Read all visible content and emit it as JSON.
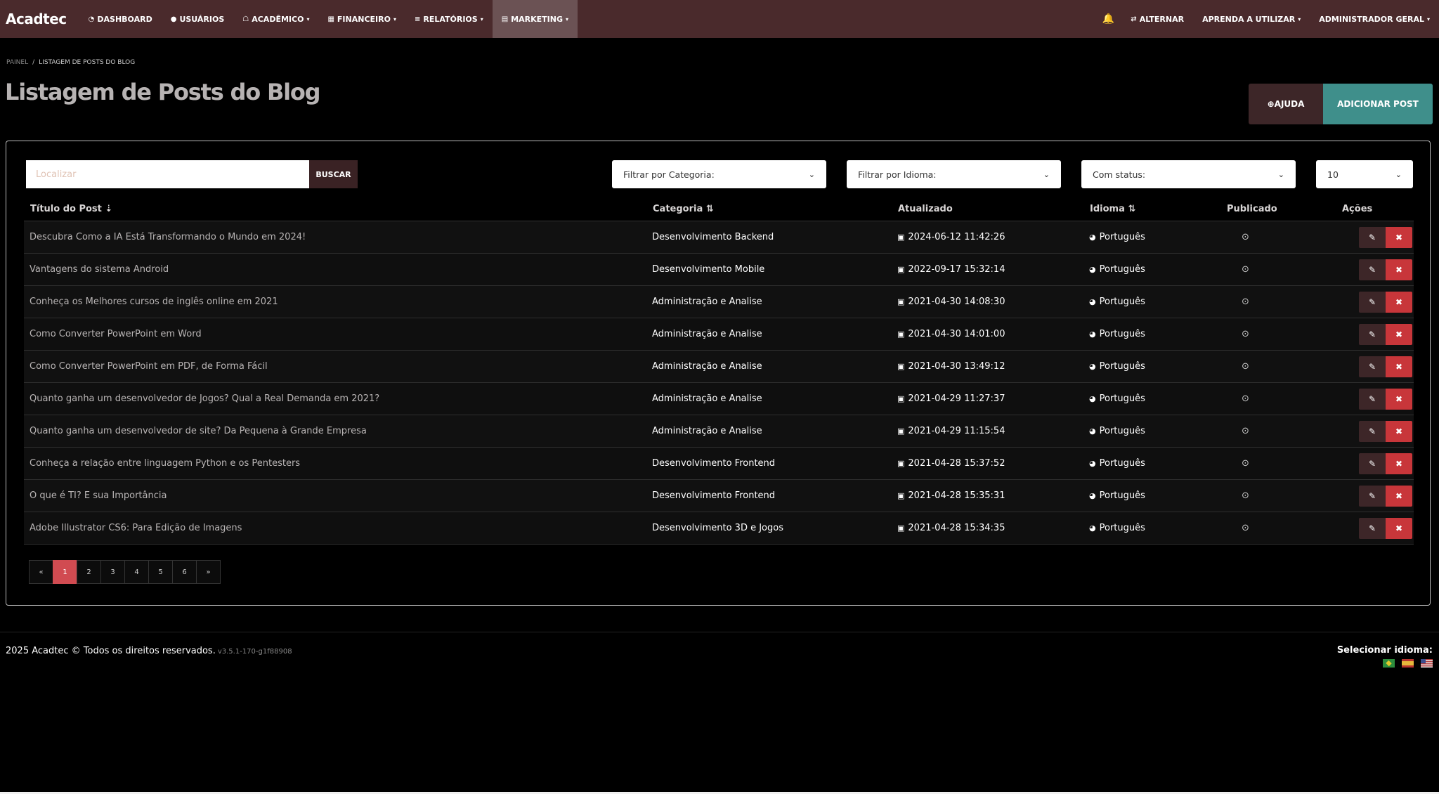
{
  "navbar": {
    "brand": "Acadtec",
    "items": [
      {
        "label": "DASHBOARD",
        "icon": "dashboard-icon",
        "glyph": "◔",
        "dropdown": false
      },
      {
        "label": "USUÁRIOS",
        "icon": "user-icon",
        "glyph": "●",
        "dropdown": false
      },
      {
        "label": "ACADÊMICO",
        "icon": "graduation-icon",
        "glyph": "☖",
        "dropdown": true
      },
      {
        "label": "FINANCEIRO",
        "icon": "calculator-icon",
        "glyph": "▦",
        "dropdown": true
      },
      {
        "label": "RELATÓRIOS",
        "icon": "chart-icon",
        "glyph": "≡",
        "dropdown": true
      },
      {
        "label": "MARKETING",
        "icon": "newspaper-icon",
        "glyph": "▤",
        "dropdown": true
      }
    ],
    "right": {
      "bell_glyph": "🔔",
      "toggle_label": "ALTERNAR",
      "toggle_glyph": "⇄",
      "learn_label": "APRENDA A UTILIZAR",
      "user_label": "ADMINISTRADOR GERAL"
    }
  },
  "breadcrumb": {
    "home": "PAINEL",
    "sep": "/",
    "current": "LISTAGEM DE POSTS DO BLOG"
  },
  "page_title": "Listagem de Posts do Blog",
  "actions": {
    "help_label": "AJUDA",
    "help_glyph": "⊕",
    "add_label": "ADICIONAR POST"
  },
  "filters": {
    "search_placeholder": "Localizar",
    "search_button": "BUSCAR",
    "category": "Filtrar por Categoria:",
    "language": "Filtrar por Idioma:",
    "status": "Com status:",
    "per_page": "10"
  },
  "table": {
    "headers": {
      "title": "Título do Post",
      "title_sort": "⇣",
      "category": "Categoria",
      "category_sort": "⇅",
      "updated": "Atualizado",
      "language": "Idioma",
      "language_sort": "⇅",
      "published": "Publicado",
      "actions": "Ações"
    },
    "rows": [
      {
        "title": "Descubra Como a IA Está Transformando o Mundo em 2024!",
        "category": "Desenvolvimento Backend",
        "updated": "2024-06-12 11:42:26",
        "language": "Português"
      },
      {
        "title": "Vantagens do sistema Android",
        "category": "Desenvolvimento Mobile",
        "updated": "2022-09-17 15:32:14",
        "language": "Português"
      },
      {
        "title": "Conheça os Melhores cursos de inglês online em 2021",
        "category": "Administração e Analise",
        "updated": "2021-04-30 14:08:30",
        "language": "Português"
      },
      {
        "title": "Como Converter PowerPoint em Word",
        "category": "Administração e Analise",
        "updated": "2021-04-30 14:01:00",
        "language": "Português"
      },
      {
        "title": "Como Converter PowerPoint em PDF, de Forma Fácil",
        "category": "Administração e Analise",
        "updated": "2021-04-30 13:49:12",
        "language": "Português"
      },
      {
        "title": "Quanto ganha um desenvolvedor de Jogos? Qual a Real Demanda em 2021?",
        "category": "Administração e Analise",
        "updated": "2021-04-29 11:27:37",
        "language": "Português"
      },
      {
        "title": "Quanto ganha um desenvolvedor de site? Da Pequena à Grande Empresa",
        "category": "Administração e Analise",
        "updated": "2021-04-29 11:15:54",
        "language": "Português"
      },
      {
        "title": "Conheça a relação entre linguagem Python e os Pentesters",
        "category": "Desenvolvimento Frontend",
        "updated": "2021-04-28 15:37:52",
        "language": "Português"
      },
      {
        "title": "O que é TI? E sua Importância",
        "category": "Desenvolvimento Frontend",
        "updated": "2021-04-28 15:35:31",
        "language": "Português"
      },
      {
        "title": "Adobe Illustrator CS6: Para Edição de Imagens",
        "category": "Desenvolvimento 3D e Jogos",
        "updated": "2021-04-28 15:34:35",
        "language": "Português"
      }
    ]
  },
  "pagination": {
    "prev": "«",
    "pages": [
      "1",
      "2",
      "3",
      "4",
      "5",
      "6"
    ],
    "next": "»",
    "current": "1"
  },
  "footer": {
    "copyright": "2025 Acadtec © Todos os direitos reservados.",
    "version": "v3.5.1-170-g1f88908",
    "language_label": "Selecionar idioma:"
  },
  "icons": {
    "calendar": "▣",
    "globe": "◕",
    "check": "⊙",
    "edit": "✎",
    "delete": "✖",
    "caret": "▾",
    "chevron": "⌄"
  },
  "colors": {
    "navbar": "#4a2a2c",
    "add_button": "#3f8f8b",
    "delete_button": "#c8363a",
    "active_page": "#d14b51"
  }
}
